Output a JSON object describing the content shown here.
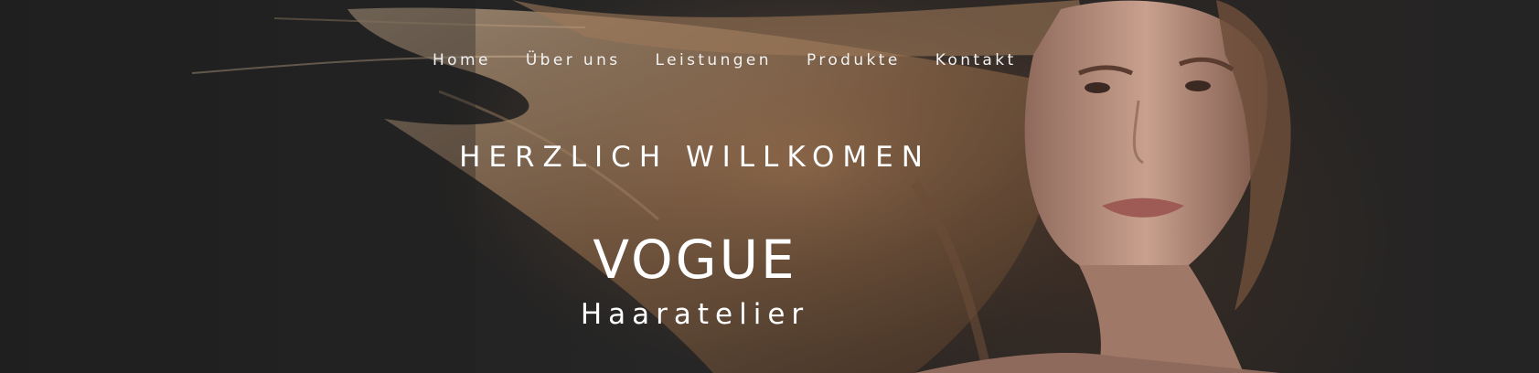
{
  "nav": {
    "items": [
      {
        "label": "Home"
      },
      {
        "label": "Über uns"
      },
      {
        "label": "Leistungen"
      },
      {
        "label": "Produkte"
      },
      {
        "label": "Kontakt"
      }
    ]
  },
  "hero": {
    "welcome": "HERZLICH WILLKOMEN",
    "brand": "VOGUE",
    "subtitle": "Haaratelier",
    "image": "woman-with-flowing-blonde-hair"
  },
  "colors": {
    "background": "#232323",
    "text": "#ffffff",
    "hair": "#b8926e",
    "skin": "#c79a86"
  }
}
